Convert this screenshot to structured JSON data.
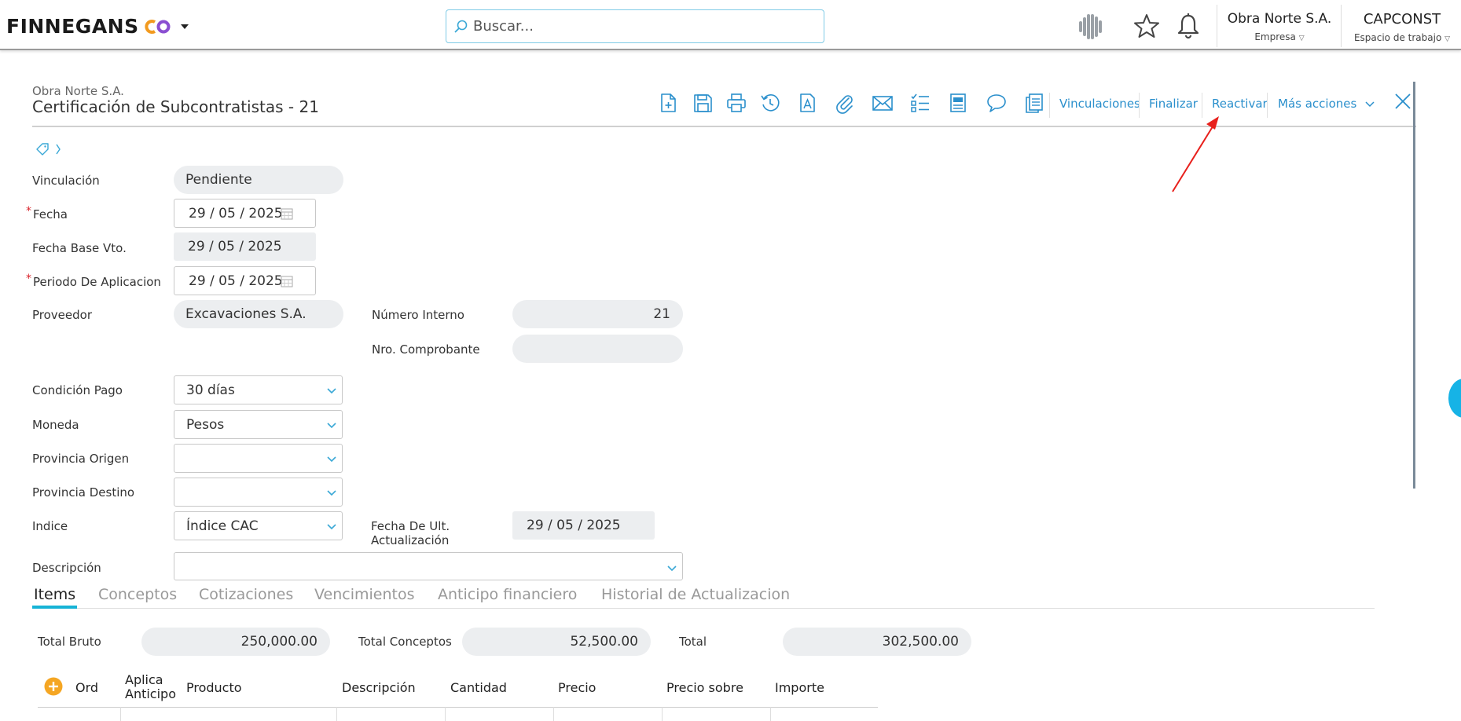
{
  "topbar": {
    "brand": "FINNEGANS",
    "search_placeholder": "Buscar...",
    "company_name": "Obra Norte S.A.",
    "company_sub": "Empresa",
    "workspace_name": "CAPCONST",
    "workspace_sub": "Espacio de trabajo"
  },
  "header": {
    "company": "Obra Norte S.A.",
    "title": "Certificación de Subcontratistas - 21",
    "toolbar_icons": [
      "new-document-icon",
      "save-icon",
      "print-icon",
      "history-icon",
      "document-text-icon",
      "attachment-icon",
      "email-icon",
      "checklist-icon",
      "report-icon",
      "comment-icon",
      "copy-icon"
    ],
    "actions": {
      "vinculaciones": "Vinculaciones",
      "finalizar": "Finalizar",
      "reactivar": "Reactivar",
      "mas_acciones": "Más acciones"
    }
  },
  "form": {
    "vinculacion": {
      "label": "Vinculación",
      "value": "Pendiente"
    },
    "fecha": {
      "label": "Fecha",
      "value": "29 / 05 / 2025",
      "required": "*"
    },
    "fecha_base_vto": {
      "label": "Fecha Base Vto.",
      "value": "29 / 05 / 2025"
    },
    "periodo": {
      "label": "Periodo De Aplicacion",
      "value": "29 / 05 / 2025",
      "required": "*"
    },
    "proveedor": {
      "label": "Proveedor",
      "value": "Excavaciones S.A."
    },
    "numero_interno": {
      "label": "Número Interno",
      "value": "21"
    },
    "nro_comprobante": {
      "label": "Nro. Comprobante",
      "value": ""
    },
    "condicion_pago": {
      "label": "Condición Pago",
      "value": "30 días"
    },
    "moneda": {
      "label": "Moneda",
      "value": "Pesos"
    },
    "provincia_origen": {
      "label": "Provincia Origen",
      "value": ""
    },
    "provincia_destino": {
      "label": "Provincia Destino",
      "value": ""
    },
    "indice": {
      "label": "Indice",
      "value": "Índice CAC"
    },
    "fecha_ult_act": {
      "label_1": "Fecha De Ult.",
      "label_2": "Actualización",
      "value": "29 / 05 / 2025"
    },
    "descripcion": {
      "label": "Descripción",
      "value": ""
    }
  },
  "tabs": [
    "Items",
    "Conceptos",
    "Cotizaciones",
    "Vencimientos",
    "Anticipo financiero",
    "Historial de Actualizacion"
  ],
  "totals": {
    "bruto": {
      "label": "Total Bruto",
      "value": "250,000.00"
    },
    "conceptos": {
      "label": "Total Conceptos",
      "value": "52,500.00"
    },
    "total": {
      "label": "Total",
      "value": "302,500.00"
    }
  },
  "table": {
    "headers": {
      "ord": "Ord",
      "aplica_1": "Aplica",
      "aplica_2": "Anticipo",
      "producto": "Producto",
      "descripcion": "Descripción",
      "cantidad": "Cantidad",
      "precio": "Precio",
      "precio_sobre": "Precio sobre",
      "importe": "Importe"
    }
  },
  "colors": {
    "accent": "#2a8fcc",
    "tab_underline": "#16b3d6",
    "required": "#d9242c",
    "annotation_arrow": "#e8201c"
  }
}
